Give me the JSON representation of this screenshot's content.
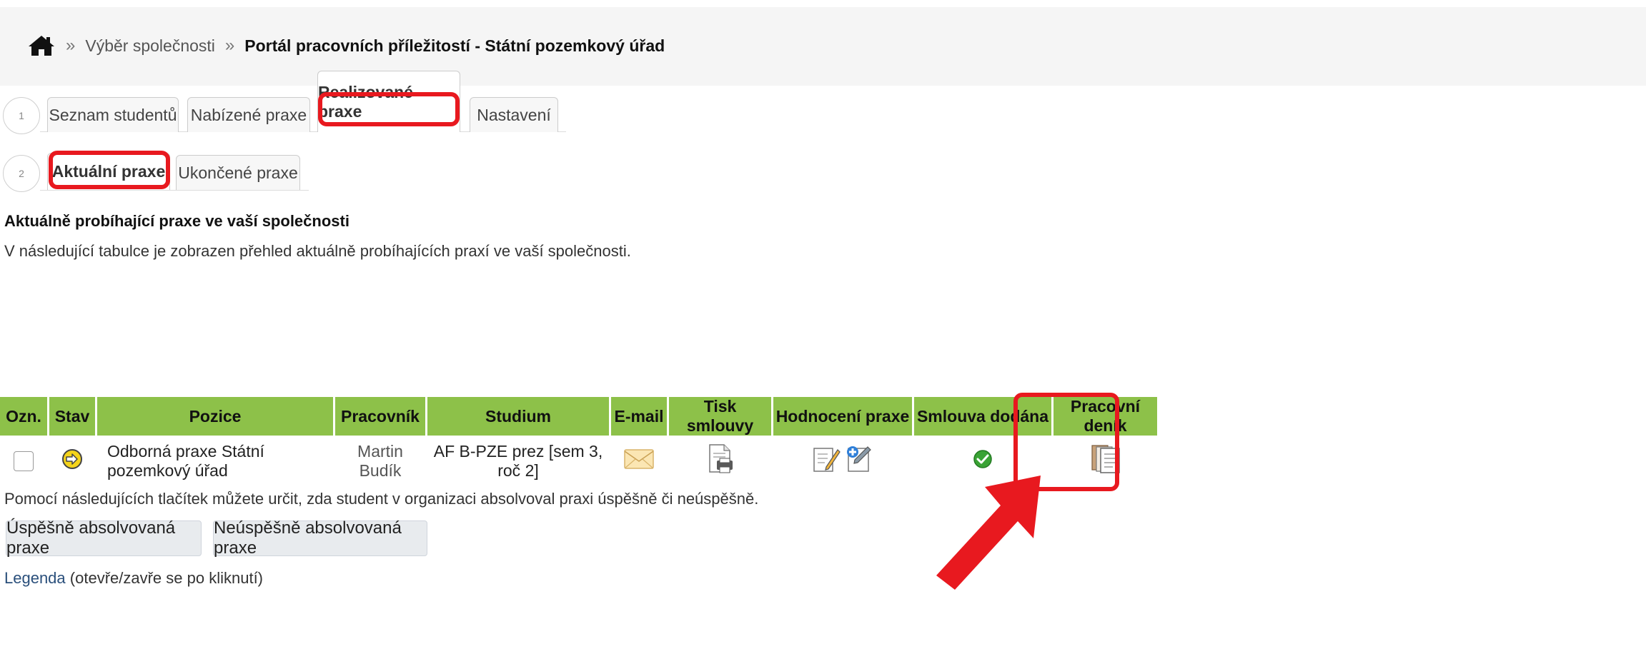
{
  "breadcrumb": {
    "separator": "»",
    "link": "Výběr společnosti",
    "current": "Portál pracovních příležitostí - Státní pozemkový úřad"
  },
  "steps": [
    "1",
    "2"
  ],
  "tabs_primary": [
    {
      "label": "Seznam studentů",
      "active": false
    },
    {
      "label": "Nabízené praxe",
      "active": false
    },
    {
      "label": "Realizované praxe",
      "active": true
    },
    {
      "label": "Nastavení",
      "active": false
    }
  ],
  "tabs_secondary": [
    {
      "label": "Aktuální praxe",
      "active": true
    },
    {
      "label": "Ukončené praxe",
      "active": false
    }
  ],
  "section_title": "Aktuálně probíhající praxe ve vaší společnosti",
  "section_desc": "V následující tabulce je zobrazen přehled aktuálně probíhajících praxí ve vaší společnosti.",
  "table": {
    "headers": [
      "Ozn.",
      "Stav",
      "Pozice",
      "Pracovník",
      "Studium",
      "E-mail",
      "Tisk smlouvy",
      "Hodnocení praxe",
      "Smlouva dodána",
      "Pracovní deník"
    ],
    "rows": [
      {
        "checked": false,
        "status_icon": "arrow-right-circle-icon",
        "position": "Odborná praxe Státní pozemkový úřad",
        "worker": "Martin Budík",
        "study": "AF B-PZE prez [sem 3, roč 2]",
        "email_icon": "envelope-icon",
        "print_icon": "print-document-icon",
        "evaluation_icons": [
          "edit-document-icon",
          "add-evaluation-icon"
        ],
        "contract_delivered": true,
        "diary_icon": "documents-stack-icon"
      }
    ]
  },
  "result_text": "Pomocí následujících tlačítek můžete určit, zda student v organizaci absolvoval praxi úspěšně či neúspěšně.",
  "buttons": {
    "success": "Úspěšně absolvovaná praxe",
    "fail": "Neúspěšně absolvovaná praxe"
  },
  "legend": {
    "link": "Legenda",
    "hint": "(otevře/zavře se po kliknutí)"
  },
  "colors": {
    "header_green": "#8dc149",
    "highlight_red": "#e8191f",
    "ok_green": "#3aa335"
  }
}
